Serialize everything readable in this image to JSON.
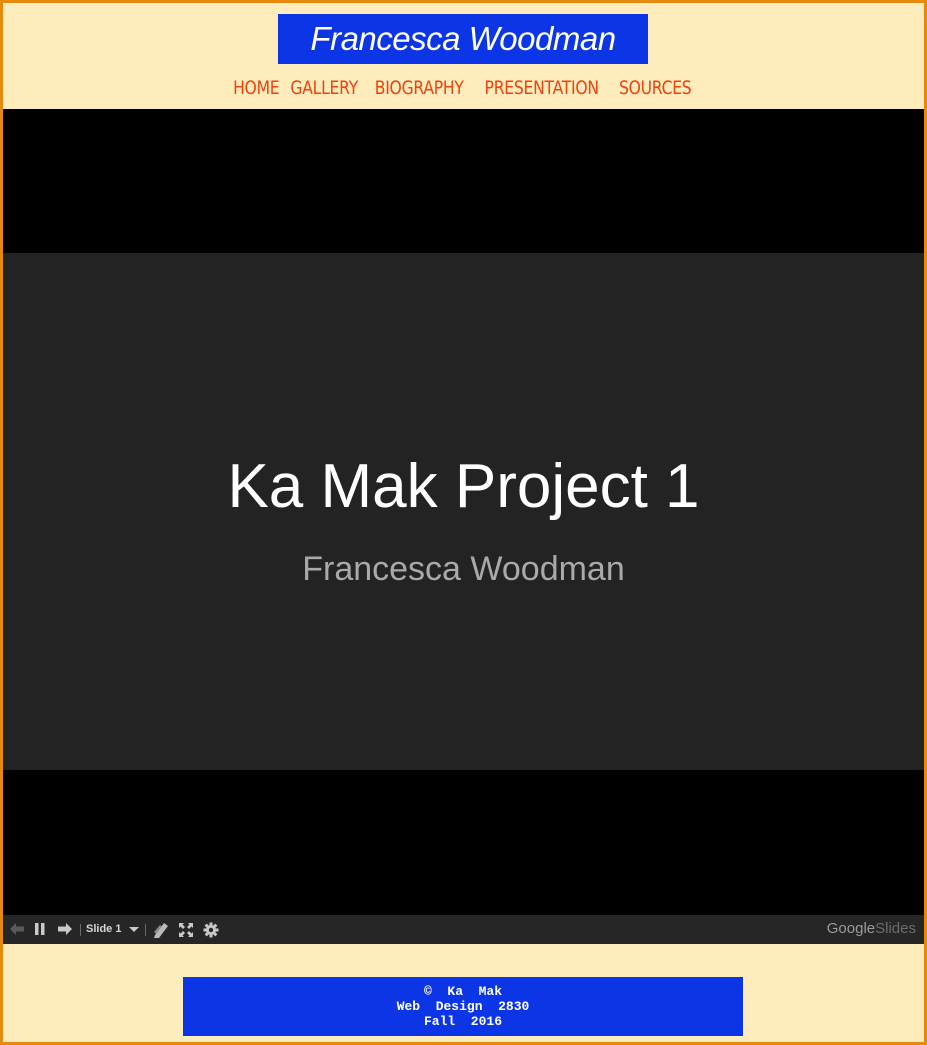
{
  "header": {
    "title": "Francesca Woodman"
  },
  "nav": {
    "items": [
      "HOME",
      "GALLERY",
      "BIOGRAPHY",
      "PRESENTATION",
      "SOURCES"
    ]
  },
  "slide": {
    "title": "Ka Mak Project 1",
    "subtitle": "Francesca Woodman"
  },
  "player": {
    "slide_label": "Slide 1",
    "brand_google": "Google",
    "brand_slides": "Slides",
    "icons": [
      "prev-arrow-icon",
      "pause-icon",
      "next-arrow-icon",
      "dropdown-caret-icon",
      "pencil-icon",
      "fullscreen-icon",
      "gear-icon"
    ]
  },
  "footer": {
    "line1": "©  Ka  Mak",
    "line2": "Web  Design  2830",
    "line3": "Fall  2016"
  },
  "colors": {
    "border": "#e5890f",
    "page_bg": "#feecbc",
    "title_bg": "#0c36e5",
    "nav_link": "#f0420a",
    "slide_bg": "#232323"
  }
}
